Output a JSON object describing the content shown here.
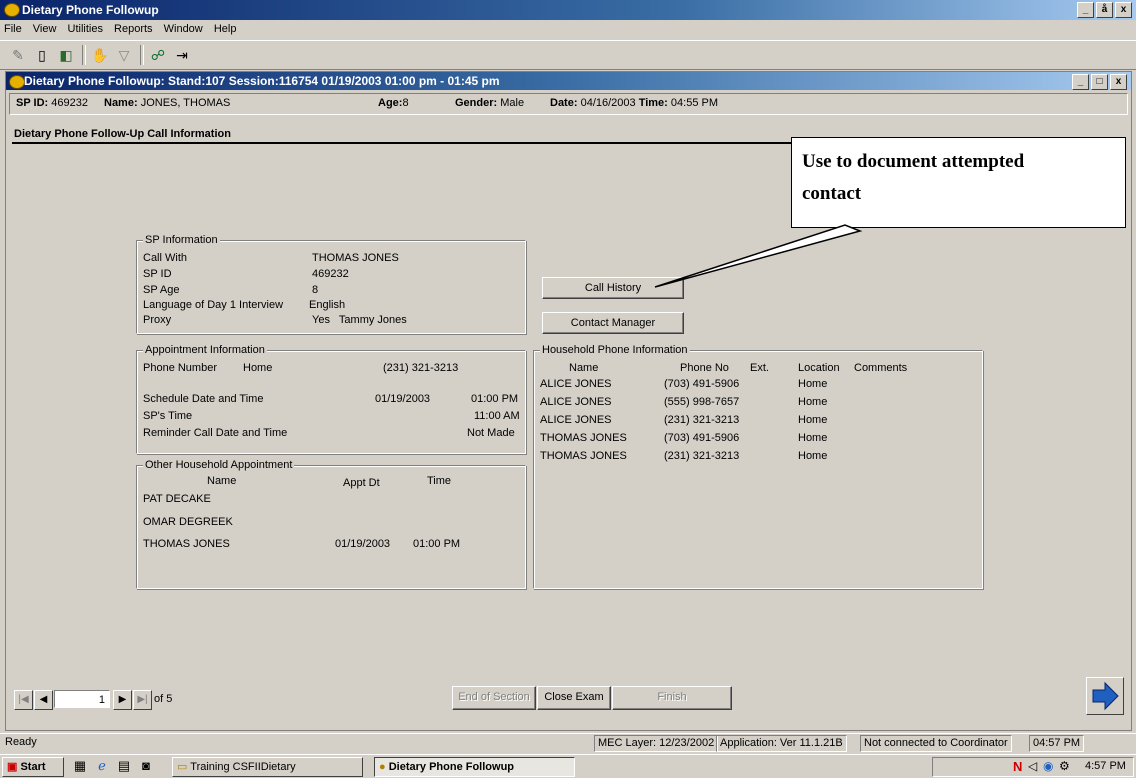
{
  "app": {
    "title": "Dietary Phone Followup",
    "window_controls": [
      "_",
      "å",
      "x"
    ]
  },
  "menu": [
    "File",
    "View",
    "Utilities",
    "Reports",
    "Window",
    "Help"
  ],
  "child_window": {
    "title": "Dietary Phone Followup: Stand:107 Session:116754 01/19/2003 01:00 pm - 01:45 pm"
  },
  "info": {
    "sp_id_label": "SP ID:",
    "sp_id": "469232",
    "name_label": "Name:",
    "name": "JONES, THOMAS",
    "age_label": "Age:",
    "age": "8",
    "gender_label": "Gender:",
    "gender": "Male",
    "date_label": "Date:",
    "date": "04/16/2003",
    "time_label": "Time:",
    "time": "04:55 PM"
  },
  "section_title": "Dietary Phone Follow-Up Call Information",
  "callout": {
    "line1": "Use to document attempted",
    "line2": "contact"
  },
  "sp_info": {
    "legend": "SP Information",
    "rows": [
      {
        "label": "Call With",
        "value": "THOMAS JONES"
      },
      {
        "label": "SP ID",
        "value": "469232"
      },
      {
        "label": "SP Age",
        "value": "8"
      },
      {
        "label": "Language of Day 1 Interview",
        "value": "English"
      },
      {
        "label": "Proxy",
        "value": "Yes   Tammy Jones"
      }
    ]
  },
  "appointment": {
    "legend": "Appointment Information",
    "phone_label": "Phone Number",
    "phone_type": "Home",
    "phone": "(231) 321-3213",
    "schedule_label": "Schedule Date and Time",
    "schedule_date": "01/19/2003",
    "schedule_time": "01:00 PM",
    "sp_time_label": "SP's Time",
    "sp_time": "11:00 AM",
    "reminder_label": "Reminder Call Date and Time",
    "reminder": "Not Made"
  },
  "other_household": {
    "legend": "Other Household Appointment",
    "headers": [
      "Name",
      "Appt Dt",
      "Time"
    ],
    "rows": [
      {
        "name": "PAT DECAKE",
        "date": "",
        "time": ""
      },
      {
        "name": "OMAR DEGREEK",
        "date": "",
        "time": ""
      },
      {
        "name": "THOMAS JONES",
        "date": "01/19/2003",
        "time": "01:00 PM"
      }
    ]
  },
  "buttons": {
    "call_history": "Call History",
    "contact_manager": "Contact Manager",
    "end_of_section": "End of Section",
    "close_exam": "Close Exam",
    "finish": "Finish"
  },
  "household_phone": {
    "legend": "Household Phone Information",
    "headers": [
      "Name",
      "Phone No",
      "Ext.",
      "Location",
      "Comments"
    ],
    "rows": [
      {
        "name": "ALICE JONES",
        "phone": "(703) 491-5906",
        "location": "Home"
      },
      {
        "name": "ALICE JONES",
        "phone": "(555) 998-7657",
        "location": "Home"
      },
      {
        "name": "ALICE JONES",
        "phone": "(231) 321-3213",
        "location": "Home"
      },
      {
        "name": "THOMAS JONES",
        "phone": "(703) 491-5906",
        "location": "Home"
      },
      {
        "name": "THOMAS JONES",
        "phone": "(231) 321-3213",
        "location": "Home"
      }
    ]
  },
  "pager": {
    "current": "1",
    "of_label": "of 5"
  },
  "status": {
    "ready": "Ready",
    "mec_layer": "MEC Layer: 12/23/2002",
    "application": "Application: Ver 11.1.21B",
    "coordinator": "Not connected to Coordinator",
    "time": "04:57 PM"
  },
  "taskbar": {
    "start": "Start",
    "task1": "Training CSFIIDietary",
    "task2": "Dietary Phone Followup",
    "clock": "4:57 PM"
  },
  "colors": {
    "title_active": "#0a246a",
    "face": "#d4d0c8",
    "next_arrow": "#1f5fbf"
  }
}
